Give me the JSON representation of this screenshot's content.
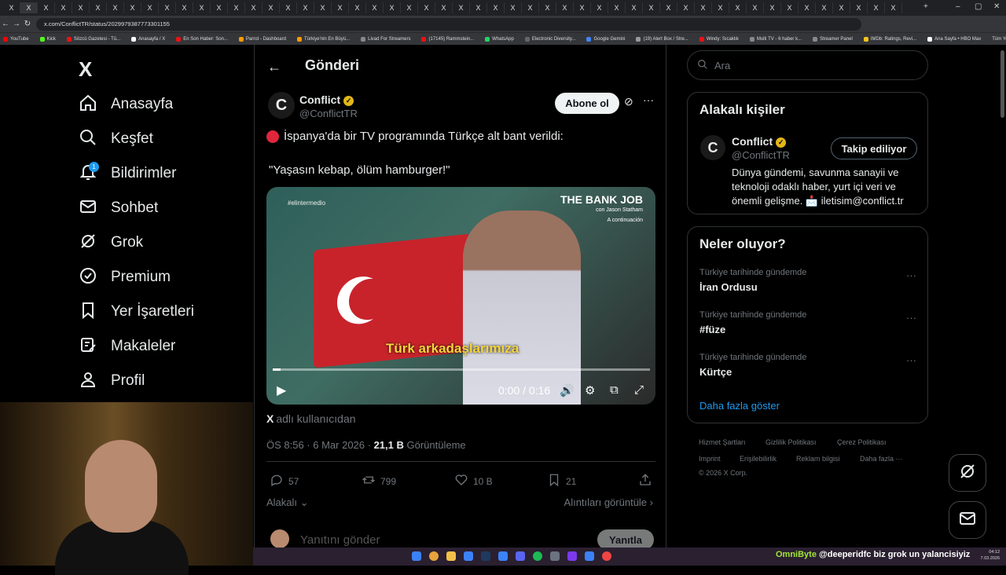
{
  "browser": {
    "tab_glyph": "X",
    "url": "x.com/ConflictTR/status/2029979387773301155",
    "bookmarks": [
      "YouTube",
      "Kick",
      "Sözcü Gazetesi - Tü...",
      "Anasayfa / X",
      "En Son Haber: Son...",
      "Parrot - Dashboard",
      "Türkiye'nin En Büyü...",
      "Livad For Streamers",
      "(17145) Rammstein...",
      "WhatsApp",
      "Electronic Diversity...",
      "Google Gemini",
      "(19) Alert Box / Stre...",
      "Windy: Sıcaklık",
      "Multi TV - 6 haber k...",
      "Streamer Panel",
      "IMDb: Ratings, Revi...",
      "Ana Sayfa • HBO Max"
    ],
    "all_bookmarks": "Tüm Yer İşaretleri"
  },
  "sidebar": {
    "logo": "X",
    "items": [
      {
        "label": "Anasayfa",
        "icon": "home-icon"
      },
      {
        "label": "Keşfet",
        "icon": "search-icon"
      },
      {
        "label": "Bildirimler",
        "icon": "bell-icon",
        "badge": "1"
      },
      {
        "label": "Sohbet",
        "icon": "mail-icon"
      },
      {
        "label": "Grok",
        "icon": "grok-icon"
      },
      {
        "label": "Premium",
        "icon": "verified-icon"
      },
      {
        "label": "Yer İşaretleri",
        "icon": "bookmark-icon"
      },
      {
        "label": "Makaleler",
        "icon": "article-icon"
      },
      {
        "label": "Profil",
        "icon": "profile-icon"
      }
    ]
  },
  "main": {
    "title": "Gönderi",
    "author": {
      "name": "Conflict",
      "handle": "@ConflictTR",
      "subscribe": "Abone ol"
    },
    "tweet": {
      "line1": "İspanya'da bir TV programında Türkçe alt bant verildi:",
      "line2": "\"Yaşasın kebap, ölüm hamburger!\""
    },
    "video": {
      "tag": "#elintermedio",
      "brand": "THE BANK JOB",
      "brand_sub": "con Jason Statham",
      "brand_sub2": "A continuación",
      "subtitle": "Türk arkadaşlarımıza",
      "time": "0:00 / 0:16",
      "progress": 0.02
    },
    "from_user": {
      "name": "X",
      "suffix": "adlı kullanıcıdan"
    },
    "meta": {
      "time": "ÖS 8:56 · 6 Mar 2026 ·",
      "views": "21,1 B",
      "views_label": "Görüntüleme"
    },
    "actions": {
      "replies": "57",
      "reposts": "799",
      "likes": "10 B",
      "bookmarks": "21"
    },
    "related": "Alakalı",
    "quotes": "Alıntıları görüntüle",
    "reply_placeholder": "Yanıtını gönder",
    "reply_button": "Yanıtla"
  },
  "right": {
    "search_placeholder": "Ara",
    "related_title": "Alakalı kişiler",
    "related_person": {
      "name": "Conflict",
      "handle": "@ConflictTR",
      "follow": "Takip ediliyor",
      "bio": "Dünya gündemi, savunma sanayii ve teknoloji odaklı haber, yurt içi veri ve önemli gelişme. 📩 iletisim@conflict.tr"
    },
    "trends_title": "Neler oluyor?",
    "trends": [
      {
        "context": "Türkiye tarihinde gündemde",
        "name": "İran Ordusu"
      },
      {
        "context": "Türkiye tarihinde gündemde",
        "name": "#füze"
      },
      {
        "context": "Türkiye tarihinde gündemde",
        "name": "Kürtçe"
      }
    ],
    "show_more": "Daha fazla göster",
    "footer": [
      "Hizmet Şartları",
      "Gizlilik Politikası",
      "Çerez Politikası",
      "Imprint",
      "Erişilebilirlik",
      "Reklam bilgisi",
      "Daha fazla ···",
      "© 2026 X Corp."
    ]
  },
  "taskbar": {
    "ticker_user": "OmniByte",
    "ticker_text": "@deeperidfc biz grok un yalancisiyiz",
    "time": "04:12",
    "date": "7.03.2026"
  }
}
